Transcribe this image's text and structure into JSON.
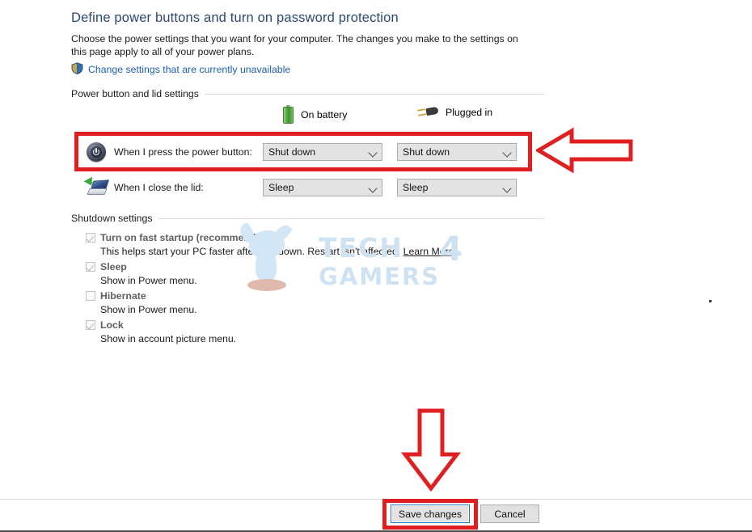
{
  "page": {
    "title": "Define power buttons and turn on password protection",
    "description": "Choose the power settings that you want for your computer. The changes you make to the settings on this page apply to all of your power plans.",
    "shield_link": "Change settings that are currently unavailable",
    "shield_icon": "uac-shield-icon"
  },
  "power_group": {
    "header": "Power button and lid settings",
    "columns": [
      {
        "label": "On battery",
        "icon": "battery-icon"
      },
      {
        "label": "Plugged in",
        "icon": "power-plug-icon"
      }
    ],
    "rows": [
      {
        "icon": "power-button-icon",
        "label": "When I press the power button:",
        "on_battery": "Shut down",
        "plugged_in": "Shut down"
      },
      {
        "icon": "laptop-lid-icon",
        "label": "When I close the lid:",
        "on_battery": "Sleep",
        "plugged_in": "Sleep"
      }
    ]
  },
  "shutdown_group": {
    "header": "Shutdown settings",
    "items": [
      {
        "label": "Turn on fast startup (recommended)",
        "checked": true,
        "description": "This helps start your PC faster after shutdown. Restart isn't affected.",
        "link": "Learn More"
      },
      {
        "label": "Sleep",
        "checked": true,
        "description": "Show in Power menu.",
        "link": ""
      },
      {
        "label": "Hibernate",
        "checked": false,
        "description": "Show in Power menu.",
        "link": ""
      },
      {
        "label": "Lock",
        "checked": true,
        "description": "Show in account picture menu.",
        "link": ""
      }
    ]
  },
  "footer": {
    "save_label": "Save changes",
    "cancel_label": "Cancel"
  },
  "watermark": {
    "line1": "TECH",
    "line2": "GAMERS",
    "four": "4"
  },
  "annotations": {
    "color": "#e02020",
    "highlight_power_row": "red-rectangle-power-button-row",
    "highlight_save": "red-rectangle-save-changes",
    "arrow_left": "red-left-arrow",
    "arrow_down": "red-down-arrow"
  }
}
